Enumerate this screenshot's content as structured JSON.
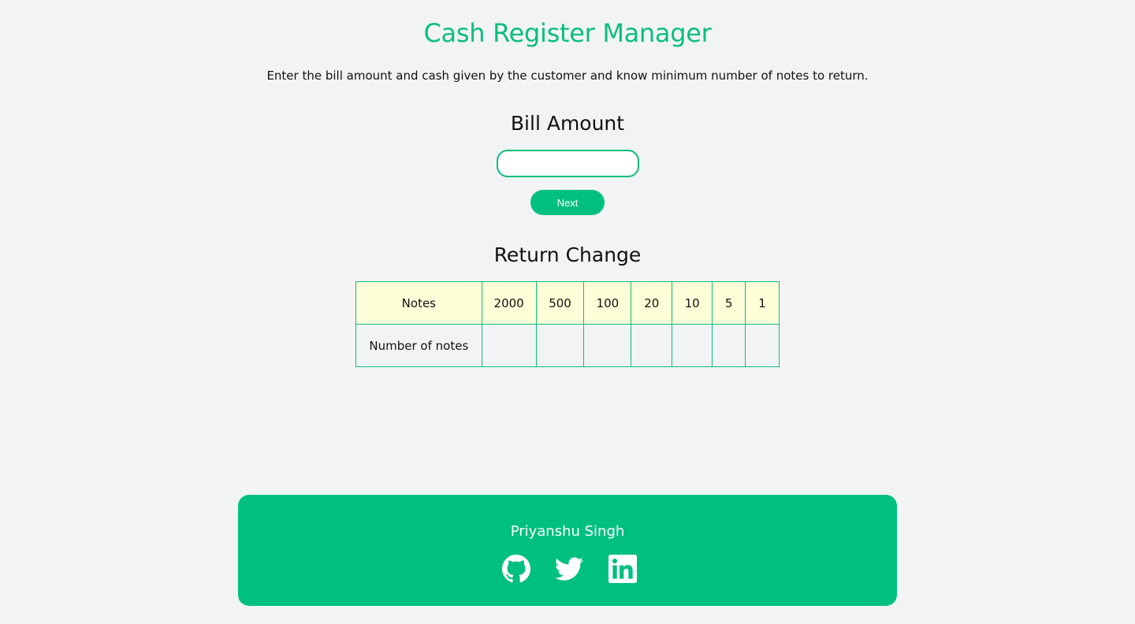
{
  "header": {
    "title": "Cash Register Manager",
    "subtitle": "Enter the bill amount and cash given by the customer and know minimum number of notes to return."
  },
  "bill": {
    "heading": "Bill Amount",
    "input_value": "",
    "next_label": "Next"
  },
  "change": {
    "heading": "Return Change",
    "row1_label": "Notes",
    "row2_label": "Number of notes",
    "notes": [
      "2000",
      "500",
      "100",
      "20",
      "10",
      "5",
      "1"
    ],
    "counts": [
      "",
      "",
      "",
      "",
      "",
      "",
      ""
    ]
  },
  "footer": {
    "author": "Priyanshu Singh",
    "links": [
      "github-icon",
      "twitter-icon",
      "linkedin-icon"
    ]
  },
  "colors": {
    "accent": "#00c07f",
    "heading_green": "#0bbf7b",
    "notes_row_bg": "#fefed8",
    "page_bg": "#f2f3f5"
  }
}
